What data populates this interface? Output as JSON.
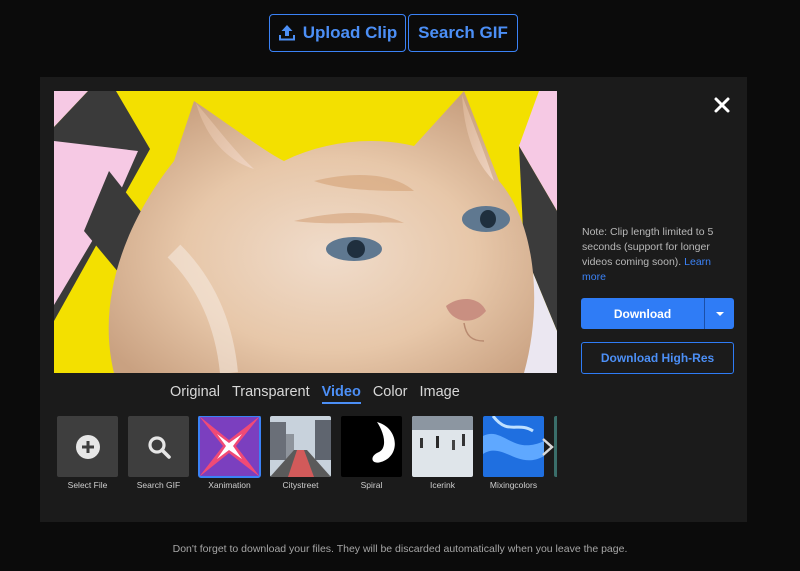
{
  "header": {
    "upload_label": "Upload Clip",
    "search_label": "Search GIF"
  },
  "editor": {
    "note_text": "Note: Clip length limited to 5 seconds (support for longer videos coming soon).",
    "learn_more": "Learn more",
    "download_label": "Download",
    "download_hires_label": "Download High-Res",
    "tabs": [
      "Original",
      "Transparent",
      "Video",
      "Color",
      "Image"
    ],
    "active_tab": "Video",
    "thumbnails": [
      {
        "label": "Select File",
        "icon": "plus-circle-icon"
      },
      {
        "label": "Search GIF",
        "icon": "magnifier-icon"
      },
      {
        "label": "Xanimation"
      },
      {
        "label": "Citystreet"
      },
      {
        "label": "Spiral"
      },
      {
        "label": "Icerink"
      },
      {
        "label": "Mixingcolors"
      }
    ],
    "selected_thumbnail": "Xanimation"
  },
  "colors": {
    "accent": "#3b82f6",
    "background": "#0b0b0b",
    "panel": "#1b1b1b"
  },
  "footer": {
    "text": "Don't forget to download your files. They will be discarded automatically when you leave the page."
  }
}
